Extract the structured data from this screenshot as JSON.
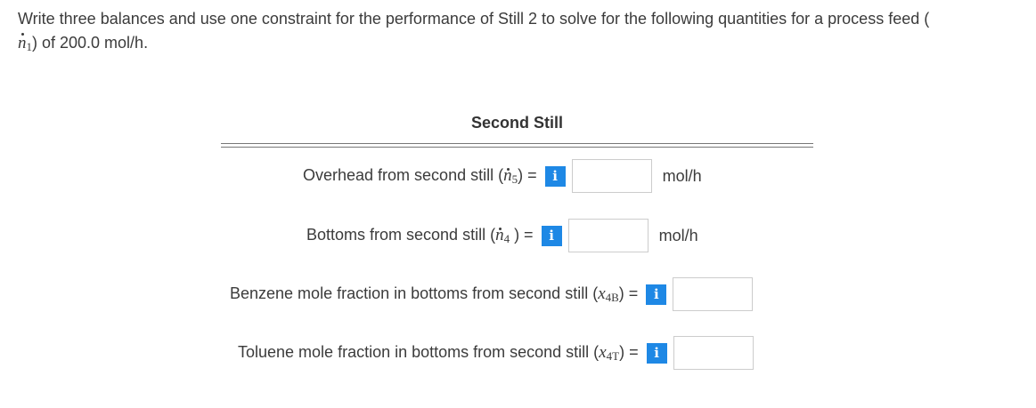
{
  "question": {
    "text_before": "Write three balances and use one constraint for the performance of Still 2 to solve for the following quantities for a process feed (",
    "feed_symbol_sub": "1",
    "text_after": ") of 200.0 mol/h."
  },
  "section": {
    "title": "Second Still"
  },
  "rows": [
    {
      "label": "Overhead from second still (",
      "symbol_sub": "5",
      "label_end": ") =",
      "info": "i",
      "value": "",
      "unit": "mol/h"
    },
    {
      "label": "Bottoms from second still (",
      "symbol_sub": "4",
      "label_end": " ) =",
      "info": "i",
      "value": "",
      "unit": "mol/h"
    },
    {
      "label": "Benzene mole fraction in bottoms from second still (",
      "symbol_sub": "4B",
      "label_end": ") =",
      "info": "i",
      "value": "",
      "unit": ""
    },
    {
      "label": "Toluene mole fraction in bottoms from second still (",
      "symbol_sub": "4T",
      "label_end": ") =",
      "info": "i",
      "value": "",
      "unit": ""
    }
  ],
  "colors": {
    "info_button": "#1e88e5",
    "text": "#3b3b3b"
  }
}
